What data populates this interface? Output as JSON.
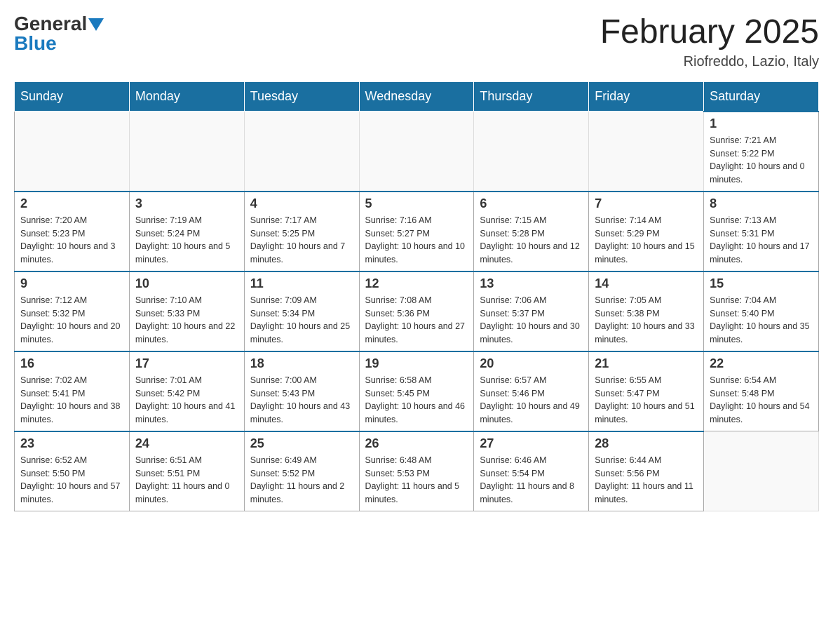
{
  "logo": {
    "general": "General",
    "blue": "Blue"
  },
  "title": "February 2025",
  "location": "Riofreddo, Lazio, Italy",
  "weekdays": [
    "Sunday",
    "Monday",
    "Tuesday",
    "Wednesday",
    "Thursday",
    "Friday",
    "Saturday"
  ],
  "weeks": [
    [
      {
        "day": "",
        "info": ""
      },
      {
        "day": "",
        "info": ""
      },
      {
        "day": "",
        "info": ""
      },
      {
        "day": "",
        "info": ""
      },
      {
        "day": "",
        "info": ""
      },
      {
        "day": "",
        "info": ""
      },
      {
        "day": "1",
        "info": "Sunrise: 7:21 AM\nSunset: 5:22 PM\nDaylight: 10 hours and 0 minutes."
      }
    ],
    [
      {
        "day": "2",
        "info": "Sunrise: 7:20 AM\nSunset: 5:23 PM\nDaylight: 10 hours and 3 minutes."
      },
      {
        "day": "3",
        "info": "Sunrise: 7:19 AM\nSunset: 5:24 PM\nDaylight: 10 hours and 5 minutes."
      },
      {
        "day": "4",
        "info": "Sunrise: 7:17 AM\nSunset: 5:25 PM\nDaylight: 10 hours and 7 minutes."
      },
      {
        "day": "5",
        "info": "Sunrise: 7:16 AM\nSunset: 5:27 PM\nDaylight: 10 hours and 10 minutes."
      },
      {
        "day": "6",
        "info": "Sunrise: 7:15 AM\nSunset: 5:28 PM\nDaylight: 10 hours and 12 minutes."
      },
      {
        "day": "7",
        "info": "Sunrise: 7:14 AM\nSunset: 5:29 PM\nDaylight: 10 hours and 15 minutes."
      },
      {
        "day": "8",
        "info": "Sunrise: 7:13 AM\nSunset: 5:31 PM\nDaylight: 10 hours and 17 minutes."
      }
    ],
    [
      {
        "day": "9",
        "info": "Sunrise: 7:12 AM\nSunset: 5:32 PM\nDaylight: 10 hours and 20 minutes."
      },
      {
        "day": "10",
        "info": "Sunrise: 7:10 AM\nSunset: 5:33 PM\nDaylight: 10 hours and 22 minutes."
      },
      {
        "day": "11",
        "info": "Sunrise: 7:09 AM\nSunset: 5:34 PM\nDaylight: 10 hours and 25 minutes."
      },
      {
        "day": "12",
        "info": "Sunrise: 7:08 AM\nSunset: 5:36 PM\nDaylight: 10 hours and 27 minutes."
      },
      {
        "day": "13",
        "info": "Sunrise: 7:06 AM\nSunset: 5:37 PM\nDaylight: 10 hours and 30 minutes."
      },
      {
        "day": "14",
        "info": "Sunrise: 7:05 AM\nSunset: 5:38 PM\nDaylight: 10 hours and 33 minutes."
      },
      {
        "day": "15",
        "info": "Sunrise: 7:04 AM\nSunset: 5:40 PM\nDaylight: 10 hours and 35 minutes."
      }
    ],
    [
      {
        "day": "16",
        "info": "Sunrise: 7:02 AM\nSunset: 5:41 PM\nDaylight: 10 hours and 38 minutes."
      },
      {
        "day": "17",
        "info": "Sunrise: 7:01 AM\nSunset: 5:42 PM\nDaylight: 10 hours and 41 minutes."
      },
      {
        "day": "18",
        "info": "Sunrise: 7:00 AM\nSunset: 5:43 PM\nDaylight: 10 hours and 43 minutes."
      },
      {
        "day": "19",
        "info": "Sunrise: 6:58 AM\nSunset: 5:45 PM\nDaylight: 10 hours and 46 minutes."
      },
      {
        "day": "20",
        "info": "Sunrise: 6:57 AM\nSunset: 5:46 PM\nDaylight: 10 hours and 49 minutes."
      },
      {
        "day": "21",
        "info": "Sunrise: 6:55 AM\nSunset: 5:47 PM\nDaylight: 10 hours and 51 minutes."
      },
      {
        "day": "22",
        "info": "Sunrise: 6:54 AM\nSunset: 5:48 PM\nDaylight: 10 hours and 54 minutes."
      }
    ],
    [
      {
        "day": "23",
        "info": "Sunrise: 6:52 AM\nSunset: 5:50 PM\nDaylight: 10 hours and 57 minutes."
      },
      {
        "day": "24",
        "info": "Sunrise: 6:51 AM\nSunset: 5:51 PM\nDaylight: 11 hours and 0 minutes."
      },
      {
        "day": "25",
        "info": "Sunrise: 6:49 AM\nSunset: 5:52 PM\nDaylight: 11 hours and 2 minutes."
      },
      {
        "day": "26",
        "info": "Sunrise: 6:48 AM\nSunset: 5:53 PM\nDaylight: 11 hours and 5 minutes."
      },
      {
        "day": "27",
        "info": "Sunrise: 6:46 AM\nSunset: 5:54 PM\nDaylight: 11 hours and 8 minutes."
      },
      {
        "day": "28",
        "info": "Sunrise: 6:44 AM\nSunset: 5:56 PM\nDaylight: 11 hours and 11 minutes."
      },
      {
        "day": "",
        "info": ""
      }
    ]
  ]
}
